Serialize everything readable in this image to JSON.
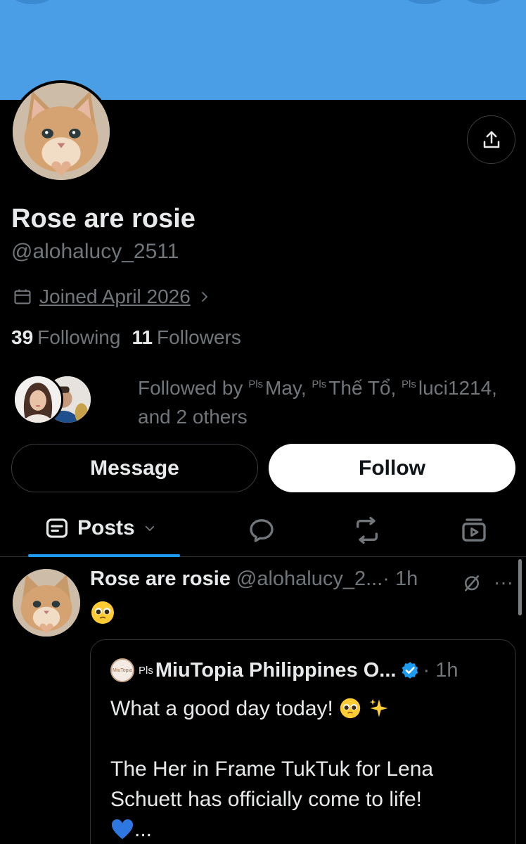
{
  "colors": {
    "background": "#000000",
    "banner": "#4a9ee6",
    "text_primary": "#e7e9ea",
    "text_secondary": "#71767b",
    "accent": "#1d9bf0",
    "border": "#2f3336"
  },
  "profile": {
    "display_name": "Rose are rosie",
    "handle": "@alohalucy_2511",
    "joined": "Joined April 2026",
    "following_count": "39",
    "following_label": "Following",
    "followers_count": "11",
    "followers_label": "Followers",
    "followed_by_prefix": "Followed by",
    "followed_by_tag": "Pls",
    "followed_by_names": [
      "May,",
      "Thế Tổ,",
      "luci1214,"
    ],
    "followed_by_suffix": "and 2 others"
  },
  "icons": {
    "share": "share-icon",
    "calendar": "calendar-icon",
    "chevron": "chevron-right-icon",
    "replies_tab": "speech-bubble-icon",
    "reposts_tab": "repost-icon",
    "media_tab": "media-icon",
    "mute": "mute-icon",
    "more": "more-icon",
    "verified": "verified-badge-icon"
  },
  "actions": {
    "message_label": "Message",
    "follow_label": "Follow"
  },
  "tabs": {
    "posts_label": "Posts"
  },
  "post": {
    "author_name": "Rose are rosie",
    "author_handle": "@alohalucy_2...",
    "time": "· 1h",
    "more": "···",
    "quote": {
      "tag": "Pls",
      "author_name": "MiuTopia Philippines O...",
      "time": "· 1h",
      "avatar_text": "MiuTopia",
      "line1": "What a good day today!",
      "line2": "The Her in Frame TukTuk for Lena Schuett has officially come to life!",
      "ellipsis": "..."
    }
  }
}
